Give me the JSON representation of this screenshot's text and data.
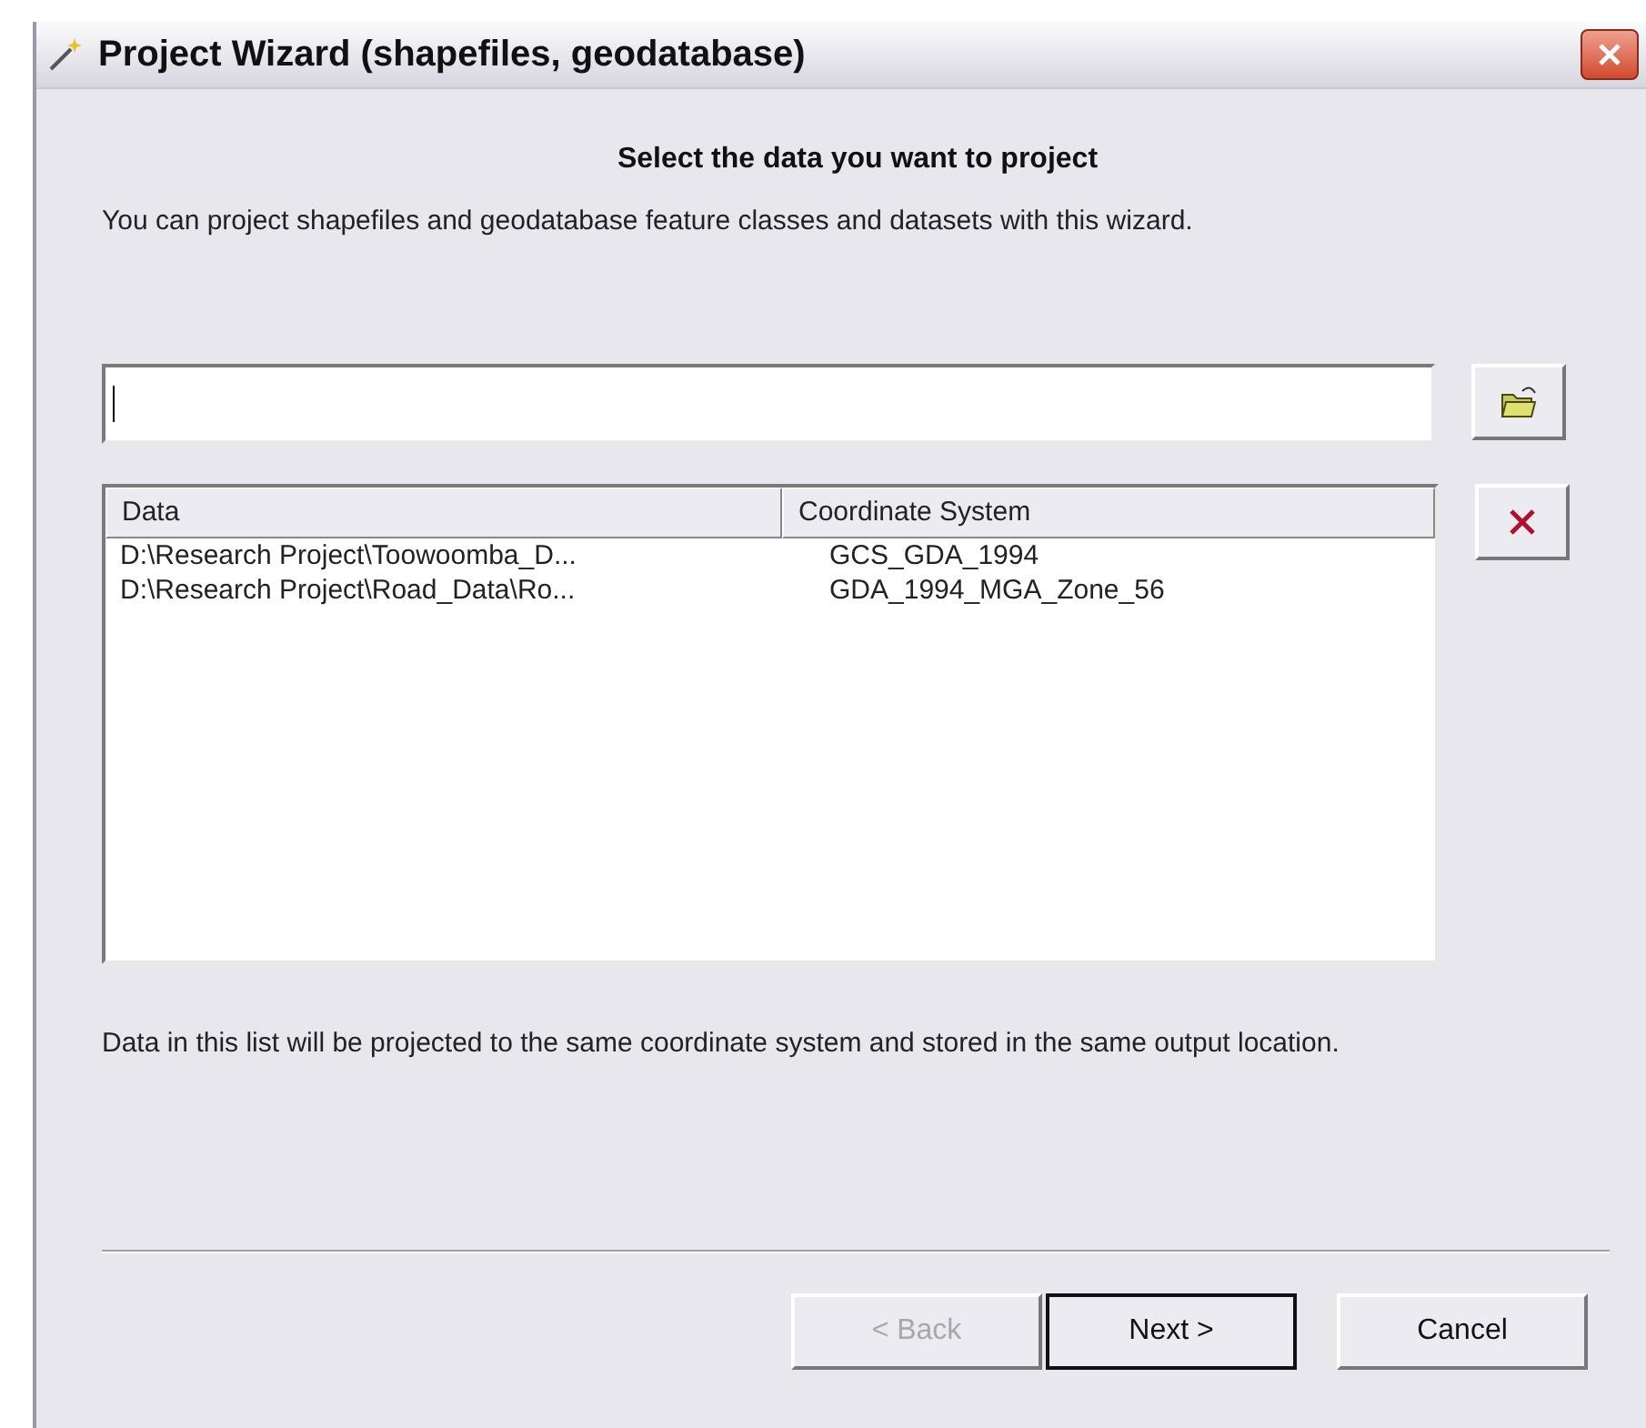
{
  "window": {
    "title": "Project Wizard (shapefiles, geodatabase)"
  },
  "heading": "Select the data you want to project",
  "description": "You can project shapefiles and geodatabase feature classes and datasets with this wizard.",
  "table": {
    "columns": [
      "Data",
      "Coordinate System"
    ],
    "rows": [
      [
        "D:\\Research Project\\Toowoomba_D...",
        "GCS_GDA_1994"
      ],
      [
        "D:\\Research Project\\Road_Data\\Ro...",
        "GDA_1994_MGA_Zone_56"
      ]
    ]
  },
  "note": "Data in this list will be projected to the same coordinate system and stored in the same output location.",
  "buttons": [
    {
      "label": "< Back",
      "disabled": true,
      "default": false
    },
    {
      "label": "Next >",
      "disabled": false,
      "default": true
    },
    {
      "label": "Cancel",
      "disabled": false,
      "default": false
    }
  ]
}
